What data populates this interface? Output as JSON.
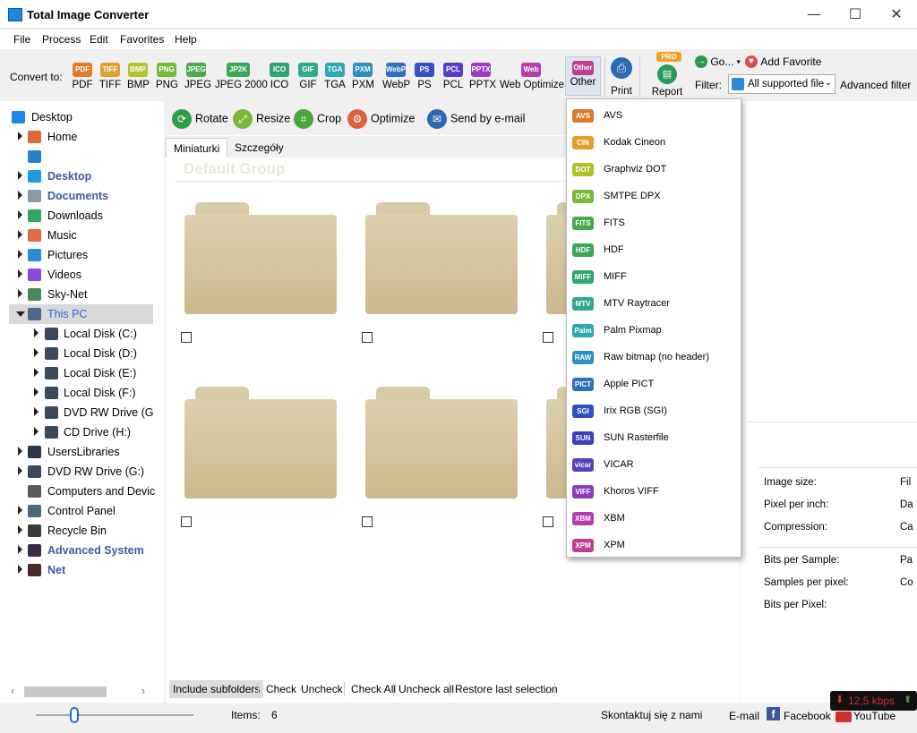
{
  "window": {
    "title": "Total Image Converter",
    "minimize": "—",
    "maximize": "☐",
    "close": "✕"
  },
  "menu": [
    "File",
    "Process",
    "Edit",
    "Favorites",
    "Help"
  ],
  "toolbar": {
    "convert_to_label": "Convert to:",
    "formats": [
      {
        "icon": "PDF",
        "label": "PDF",
        "color": "#e07b2a"
      },
      {
        "icon": "TIFF",
        "label": "TIFF",
        "color": "#e0a030"
      },
      {
        "icon": "BMP",
        "label": "BMP",
        "color": "#b6c232"
      },
      {
        "icon": "PNG",
        "label": "PNG",
        "color": "#77b83a"
      },
      {
        "icon": "JPEG",
        "label": "JPEG",
        "color": "#4fa94a"
      },
      {
        "icon": "JP2K",
        "label": "JPEG 2000",
        "color": "#3aa65a"
      },
      {
        "icon": "ICO",
        "label": "ICO",
        "color": "#2fa670"
      },
      {
        "icon": "GIF",
        "label": "GIF",
        "color": "#2eaa8f"
      },
      {
        "icon": "TGA",
        "label": "TGA",
        "color": "#2ea7b0"
      },
      {
        "icon": "PXM",
        "label": "PXM",
        "color": "#2e8ec0"
      },
      {
        "icon": "WebP",
        "label": "WebP",
        "color": "#2e6ec0"
      },
      {
        "icon": "PS",
        "label": "PS",
        "color": "#3a4ec0"
      },
      {
        "icon": "PCL",
        "label": "PCL",
        "color": "#5a3ec0"
      },
      {
        "icon": "PPTX",
        "label": "PPTX",
        "color": "#9a3ec0"
      },
      {
        "icon": "Web",
        "label": "Web Optimize",
        "color": "#b53eb0"
      }
    ],
    "other": {
      "icon": "Other",
      "label": "Other",
      "color": "#c03e90"
    },
    "print_label": "Print",
    "report_label": "Report",
    "report_badge": "PRO",
    "go_label": "Go...",
    "add_favorite_label": "Add Favorite",
    "filter_label": "Filter:",
    "filter_value": "All supported file",
    "advanced_filter_label": "Advanced filter"
  },
  "tree": [
    {
      "label": "Desktop",
      "level": 0,
      "arrow": "",
      "bold": false,
      "selected": false,
      "icon": "desktop-icon",
      "color": "#1e88e5"
    },
    {
      "label": "Home",
      "level": 1,
      "arrow": "right",
      "bold": false,
      "selected": false,
      "icon": "home-icon",
      "color": "#e0693a"
    },
    {
      "label": "",
      "level": 1,
      "arrow": "",
      "bold": false,
      "selected": false,
      "icon": "image-icon",
      "color": "#2b7fd0"
    },
    {
      "label": "Desktop",
      "level": 1,
      "arrow": "right",
      "bold": true,
      "selected": false,
      "icon": "desktop-icon",
      "color": "#1e9be5"
    },
    {
      "label": "Documents",
      "level": 1,
      "arrow": "right",
      "bold": true,
      "selected": false,
      "icon": "documents-icon",
      "color": "#8a9aa8"
    },
    {
      "label": "Downloads",
      "level": 1,
      "arrow": "right",
      "bold": false,
      "selected": false,
      "icon": "download-icon",
      "color": "#2ea860"
    },
    {
      "label": "Music",
      "level": 1,
      "arrow": "right",
      "bold": false,
      "selected": false,
      "icon": "music-icon",
      "color": "#e06a4a"
    },
    {
      "label": "Pictures",
      "level": 1,
      "arrow": "right",
      "bold": false,
      "selected": false,
      "icon": "pictures-icon",
      "color": "#2b8ad8"
    },
    {
      "label": "Videos",
      "level": 1,
      "arrow": "right",
      "bold": false,
      "selected": false,
      "icon": "video-icon",
      "color": "#8a4ad8"
    },
    {
      "label": "Sky-Net",
      "level": 1,
      "arrow": "right",
      "bold": false,
      "selected": false,
      "icon": "network-icon",
      "color": "#4a8a5a"
    },
    {
      "label": "This PC",
      "level": 1,
      "arrow": "down",
      "bold": false,
      "selected": true,
      "icon": "computer-icon",
      "color": "#4a6a8a"
    },
    {
      "label": "Local Disk (C:)",
      "level": 2,
      "arrow": "right",
      "bold": false,
      "selected": false,
      "icon": "disk-icon",
      "color": "#3a4a5a"
    },
    {
      "label": "Local Disk (D:)",
      "level": 2,
      "arrow": "right",
      "bold": false,
      "selected": false,
      "icon": "disk-icon",
      "color": "#3a4a5a"
    },
    {
      "label": "Local Disk (E:)",
      "level": 2,
      "arrow": "right",
      "bold": false,
      "selected": false,
      "icon": "disk-icon",
      "color": "#3a4a5a"
    },
    {
      "label": "Local Disk (F:)",
      "level": 2,
      "arrow": "right",
      "bold": false,
      "selected": false,
      "icon": "disk-icon",
      "color": "#3a4a5a"
    },
    {
      "label": "DVD RW Drive (G",
      "level": 2,
      "arrow": "right",
      "bold": false,
      "selected": false,
      "icon": "dvd-icon",
      "color": "#3a4a5a"
    },
    {
      "label": "CD Drive (H:)",
      "level": 2,
      "arrow": "right",
      "bold": false,
      "selected": false,
      "icon": "cd-icon",
      "color": "#3a4a5a"
    },
    {
      "label": "UsersLibraries",
      "level": 1,
      "arrow": "right",
      "bold": false,
      "selected": false,
      "icon": "library-icon",
      "color": "#2a3a4a"
    },
    {
      "label": "DVD RW Drive (G:)",
      "level": 1,
      "arrow": "right",
      "bold": false,
      "selected": false,
      "icon": "dvd-icon",
      "color": "#3a4a5a"
    },
    {
      "label": "Computers and Devic",
      "level": 1,
      "arrow": "",
      "bold": false,
      "selected": false,
      "icon": "gear-icon",
      "color": "#5a5a5a"
    },
    {
      "label": "Control Panel",
      "level": 1,
      "arrow": "right",
      "bold": false,
      "selected": false,
      "icon": "control-panel-icon",
      "color": "#4a6a7a"
    },
    {
      "label": "Recycle Bin",
      "level": 1,
      "arrow": "right",
      "bold": false,
      "selected": false,
      "icon": "recycle-bin-icon",
      "color": "#3a3a3a"
    },
    {
      "label": "Advanced System",
      "level": 1,
      "arrow": "right",
      "bold": true,
      "selected": false,
      "icon": "advanced-system-icon",
      "color": "#3a2a4a"
    },
    {
      "label": "Net",
      "level": 1,
      "arrow": "right",
      "bold": true,
      "selected": false,
      "icon": "net-icon",
      "color": "#4a2a2a"
    }
  ],
  "actions": [
    {
      "label": "Rotate",
      "color": "#2e9e4a",
      "glyph": "⟳"
    },
    {
      "label": "Resize",
      "color": "#7ab83a",
      "glyph": "⤢"
    },
    {
      "label": "Crop",
      "color": "#4aa63a",
      "glyph": "⌗"
    },
    {
      "label": "Optimize",
      "color": "#e0603a",
      "glyph": "⚙"
    },
    {
      "label": "Send by e-mail",
      "color": "#2a6ab0",
      "glyph": "✉"
    }
  ],
  "tabs": [
    "Miniaturki",
    "Szczegóły"
  ],
  "group_title": "Default Group",
  "bottom_actions": [
    "Include subfolders",
    "Check",
    "Uncheck",
    "Check All",
    "Uncheck all",
    "Restore last selection"
  ],
  "properties": [
    {
      "label": "Image size:",
      "value": "Fil"
    },
    {
      "label": "Pixel per inch:",
      "value": "Da"
    },
    {
      "label": "Compression:",
      "value": "Ca"
    },
    {
      "label": "Bits per Sample:",
      "value": "Pa"
    },
    {
      "label": "Samples per pixel:",
      "value": "Co"
    },
    {
      "label": "Bits per Pixel:",
      "value": ""
    }
  ],
  "status": {
    "items_label": "Items:",
    "items_count": "6",
    "contact": "Skontaktuj się z nami",
    "email": "E-mail",
    "facebook": "Facebook",
    "youtube": "YouTube",
    "speed": "12,5 kbps",
    "speed_color": "#d32f2f"
  },
  "dropdown": [
    {
      "icon": "AVS",
      "label": "AVS",
      "color": "#e07a2a"
    },
    {
      "icon": "CIN",
      "label": "Kodak Cineon",
      "color": "#e0a02a"
    },
    {
      "icon": "DOT",
      "label": "Graphviz DOT",
      "color": "#b0c02a"
    },
    {
      "icon": "DPX",
      "label": "SMTPE DPX",
      "color": "#78b83a"
    },
    {
      "icon": "FITS",
      "label": "FITS",
      "color": "#4aa84a"
    },
    {
      "icon": "HDF",
      "label": "HDF",
      "color": "#3aa65a"
    },
    {
      "icon": "MIFF",
      "label": "MIFF",
      "color": "#2ea670"
    },
    {
      "icon": "MTV",
      "label": "MTV Raytracer",
      "color": "#2ea890"
    },
    {
      "icon": "Palm",
      "label": "Palm Pixmap",
      "color": "#2ea8b0"
    },
    {
      "icon": "RAW",
      "label": "Raw bitmap (no header)",
      "color": "#2e90c0"
    },
    {
      "icon": "PICT",
      "label": "Apple PICT",
      "color": "#2e70c0"
    },
    {
      "icon": "SGI",
      "label": "Irix RGB (SGI)",
      "color": "#2e50c0"
    },
    {
      "icon": "SUN",
      "label": "SUN Rasterfile",
      "color": "#3a3ec0"
    },
    {
      "icon": "vicar",
      "label": "VICAR",
      "color": "#5a3ec0"
    },
    {
      "icon": "VIFF",
      "label": "Khoros VIFF",
      "color": "#8a3ec0"
    },
    {
      "icon": "XBM",
      "label": "XBM",
      "color": "#b03eb0"
    },
    {
      "icon": "XPM",
      "label": "XPM",
      "color": "#c03e90"
    }
  ]
}
